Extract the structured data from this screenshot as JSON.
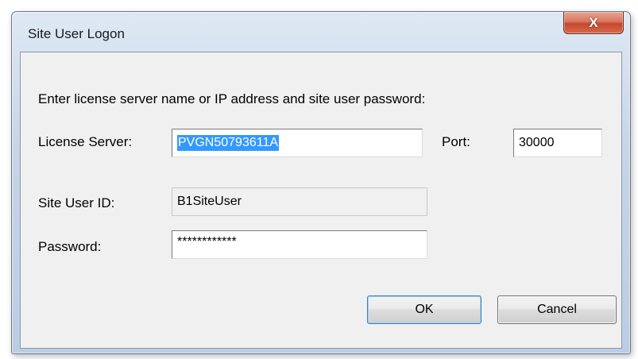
{
  "window": {
    "title": "Site User Logon",
    "close_label": "X"
  },
  "form": {
    "prompt": "Enter license server name or IP address and site user password:",
    "license_server_label": "License Server:",
    "license_server_value": "PVGN50793611A",
    "port_label": "Port:",
    "port_value": "30000",
    "site_user_id_label": "Site User ID:",
    "site_user_id_value": "B1SiteUser",
    "password_label": "Password:",
    "password_value": "************"
  },
  "buttons": {
    "ok_label": "OK",
    "cancel_label": "Cancel"
  },
  "colors": {
    "selection": "#3399ff",
    "close_button": "#c7472c",
    "titlebar": "#c6d5e8",
    "client_background": "#f0f0f0"
  },
  "icons": {
    "close": "close-x-icon"
  }
}
